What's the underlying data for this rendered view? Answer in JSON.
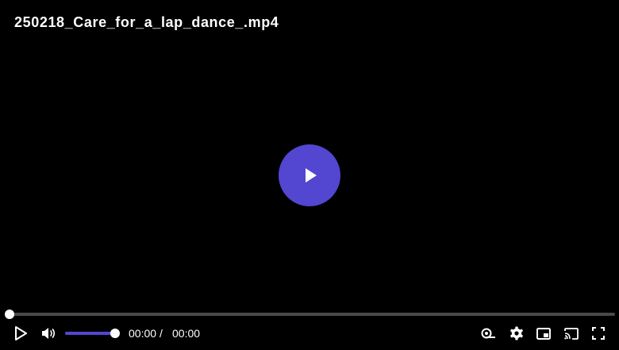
{
  "video": {
    "title": "250218_Care_for_a_lap_dance_.mp4",
    "current_time": "00:00",
    "separator": "/",
    "duration": "00:00",
    "progress": 0,
    "volume": 1.0
  },
  "icons": {
    "big_play": "play-icon",
    "play": "play-icon",
    "volume": "volume-icon",
    "speed": "playback-speed-icon",
    "settings": "gear-icon",
    "pip": "picture-in-picture-icon",
    "cast": "cast-icon",
    "fullscreen": "fullscreen-icon"
  },
  "colors": {
    "background": "#000000",
    "accent": "#5346d0",
    "track": "#4a4a4a",
    "text": "#ffffff"
  }
}
